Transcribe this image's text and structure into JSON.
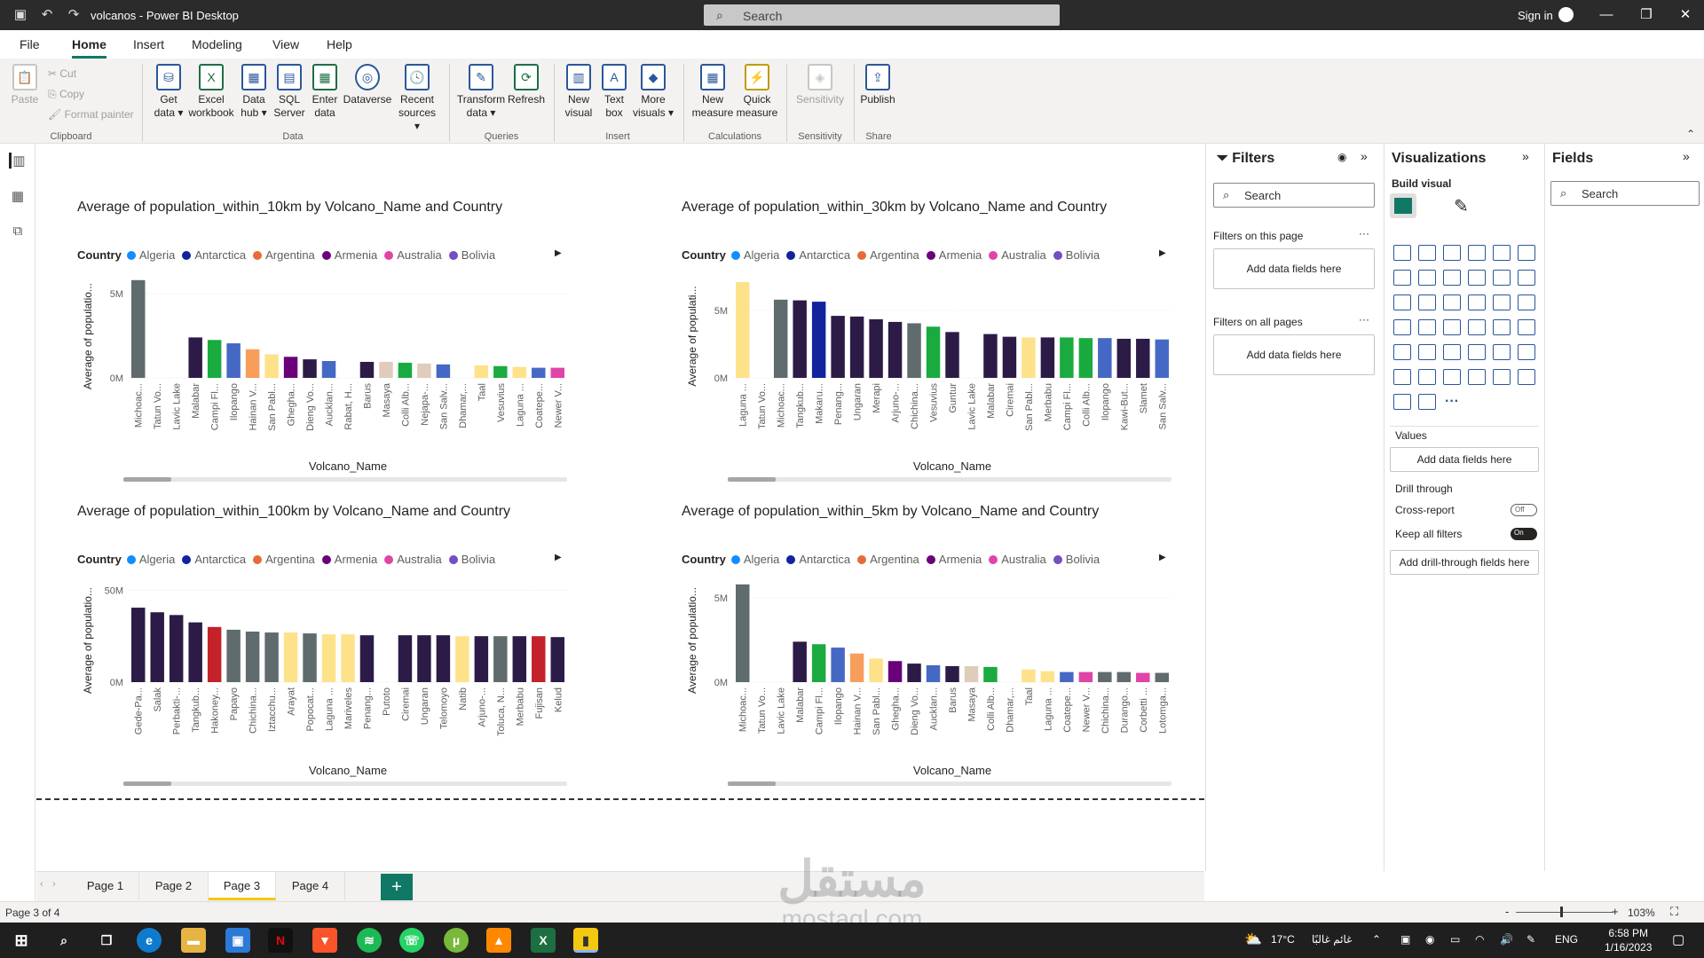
{
  "window": {
    "title": "volcanos - Power BI Desktop",
    "search_placeholder": "Search",
    "signin": "Sign in"
  },
  "menu": [
    "File",
    "Home",
    "Insert",
    "Modeling",
    "View",
    "Help"
  ],
  "ribbon": {
    "clipboard": {
      "paste": "Paste",
      "cut": "Cut",
      "copy": "Copy",
      "format_painter": "Format painter",
      "group": "Clipboard"
    },
    "data": {
      "get_data": "Get data ▾",
      "excel": "Excel workbook",
      "data_hub": "Data hub ▾",
      "sql": "SQL Server",
      "enter": "Enter data",
      "dataverse": "Dataverse",
      "recent": "Recent sources ▾",
      "group": "Data"
    },
    "queries": {
      "transform": "Transform data ▾",
      "refresh": "Refresh",
      "group": "Queries"
    },
    "insert": {
      "new_visual": "New visual",
      "text_box": "Text box",
      "more_visuals": "More visuals ▾",
      "group": "Insert"
    },
    "calculations": {
      "new_measure": "New measure",
      "quick_measure": "Quick measure",
      "group": "Calculations"
    },
    "sensitivity": {
      "sensitivity": "Sensitivity",
      "group": "Sensitivity"
    },
    "share": {
      "publish": "Publish",
      "group": "Share"
    }
  },
  "legend": {
    "label": "Country",
    "items": [
      {
        "name": "Algeria",
        "color": "#118dff"
      },
      {
        "name": "Antarctica",
        "color": "#12239e"
      },
      {
        "name": "Argentina",
        "color": "#e66c37"
      },
      {
        "name": "Armenia",
        "color": "#6b007b"
      },
      {
        "name": "Australia",
        "color": "#e044a7"
      },
      {
        "name": "Bolivia",
        "color": "#744ec2"
      }
    ]
  },
  "chart_data": [
    {
      "type": "bar",
      "title": "Average of population_within_10km by Volcano_Name and Country",
      "xlabel": "Volcano_Name",
      "ylabel": "Average of populatio...",
      "yticks": [
        "0M",
        "5M"
      ],
      "ylim": [
        0,
        6000000
      ],
      "categories": [
        "Michoac...",
        "Tatun Vo...",
        "Lavic Lake",
        "Malabar",
        "Campi Fl...",
        "Ilopango",
        "Hainan V...",
        "San Pabl...",
        "Ghegha...",
        "Dieng Vo...",
        "Aucklan...",
        "Rabat, H...",
        "Barus",
        "Masaya",
        "Colli Alb...",
        "Nejapa-...",
        "San Salv...",
        "Dhamar,...",
        "Taal",
        "Vesuvius",
        "Laguna ...",
        "Coatepe...",
        "Newer V..."
      ],
      "values": [
        5800000,
        0,
        0,
        2400000,
        2250000,
        2050000,
        1700000,
        1400000,
        1250000,
        1100000,
        1000000,
        0,
        950000,
        950000,
        900000,
        850000,
        800000,
        0,
        750000,
        700000,
        650000,
        600000,
        600000
      ],
      "colors": [
        "#5f6b6d",
        "#fff",
        "#fff",
        "#2c1b47",
        "#1aab40",
        "#4668c5",
        "#f79e5d",
        "#fde28a",
        "#6b007b",
        "#2c1b47",
        "#4668c5",
        "#fff",
        "#2c1b47",
        "#e0ccbb",
        "#1aab40",
        "#e0ccbb",
        "#4668c5",
        "#fff",
        "#fde28a",
        "#1aab40",
        "#fde28a",
        "#4668c5",
        "#e044a7"
      ]
    },
    {
      "type": "bar",
      "title": "Average of population_within_30km by Volcano_Name and Country",
      "xlabel": "Volcano_Name",
      "ylabel": "Average of populati...",
      "yticks": [
        "0M",
        "5M"
      ],
      "ylim": [
        0,
        7500000
      ],
      "categories": [
        "Laguna ...",
        "Tatun Vo...",
        "Michoac...",
        "Tangkub...",
        "Makaru...",
        "Penang...",
        "Ungaran",
        "Merapi",
        "Arjuno-...",
        "Chichina...",
        "Vesuvius",
        "Guntur",
        "Lavic Lake",
        "Malabar",
        "Ciremai",
        "San Pabl...",
        "Merbabu",
        "Campi Fl...",
        "Colli Alb...",
        "Ilopango",
        "Kawi-But...",
        "Slamet",
        "San Salv..."
      ],
      "values": [
        7100000,
        0,
        5800000,
        5750000,
        5650000,
        4600000,
        4550000,
        4350000,
        4150000,
        4050000,
        3800000,
        3400000,
        0,
        3250000,
        3050000,
        3000000,
        3000000,
        3000000,
        2950000,
        2950000,
        2900000,
        2900000,
        2850000
      ],
      "colors": [
        "#fde28a",
        "#fff",
        "#5f6b6d",
        "#2c1b47",
        "#12239e",
        "#2c1b47",
        "#2c1b47",
        "#2c1b47",
        "#2c1b47",
        "#5f6b6d",
        "#1aab40",
        "#2c1b47",
        "#fff",
        "#2c1b47",
        "#2c1b47",
        "#fde28a",
        "#2c1b47",
        "#1aab40",
        "#1aab40",
        "#4668c5",
        "#2c1b47",
        "#2c1b47",
        "#4668c5"
      ]
    },
    {
      "type": "bar",
      "title": "Average of population_within_100km by Volcano_Name and Country",
      "xlabel": "Volcano_Name",
      "ylabel": "Average of populatio...",
      "yticks": [
        "0M",
        "50M"
      ],
      "ylim": [
        0,
        55000000
      ],
      "categories": [
        "Gede-Pa...",
        "Salak",
        "Perbakti-...",
        "Tangkub...",
        "Hakoney...",
        "Papayo",
        "Chichina...",
        "Iztacchu...",
        "Arayat",
        "Popocat...",
        "Laguna ...",
        "Mariveles",
        "Penang...",
        "Putoto",
        "Ciremai",
        "Ungaran",
        "Telomoyo",
        "Natib",
        "Arjuno-...",
        "Toluca, N...",
        "Merbabu",
        "Fujisan",
        "Kelud"
      ],
      "values": [
        40500000,
        38000000,
        36500000,
        32500000,
        30000000,
        28500000,
        27500000,
        27000000,
        27000000,
        26500000,
        26000000,
        26000000,
        25500000,
        0,
        25500000,
        25500000,
        25500000,
        25000000,
        25000000,
        25000000,
        25000000,
        25000000,
        24500000
      ],
      "colors": [
        "#2c1b47",
        "#2c1b47",
        "#2c1b47",
        "#2c1b47",
        "#c3222b",
        "#5f6b6d",
        "#5f6b6d",
        "#5f6b6d",
        "#fde28a",
        "#5f6b6d",
        "#fde28a",
        "#fde28a",
        "#2c1b47",
        "#fff",
        "#2c1b47",
        "#2c1b47",
        "#2c1b47",
        "#fde28a",
        "#2c1b47",
        "#5f6b6d",
        "#2c1b47",
        "#c3222b",
        "#2c1b47"
      ]
    },
    {
      "type": "bar",
      "title": "Average of population_within_5km by Volcano_Name and Country",
      "xlabel": "Volcano_Name",
      "ylabel": "Average of populatio...",
      "yticks": [
        "0M",
        "5M"
      ],
      "ylim": [
        0,
        6000000
      ],
      "categories": [
        "Michoac...",
        "Tatun Vo...",
        "Lavic Lake",
        "Malabar",
        "Campi Fl...",
        "Ilopango",
        "Hainan V...",
        "San Pabl...",
        "Ghegha...",
        "Dieng Vo...",
        "Aucklan...",
        "Barus",
        "Masaya",
        "Colli Alb...",
        "Dhamar,...",
        "Taal",
        "Laguna ...",
        "Coatepe...",
        "Newer V...",
        "Chichina...",
        "Durango...",
        "Corbetti ...",
        "Lotomga..."
      ],
      "values": [
        5800000,
        0,
        0,
        2400000,
        2250000,
        2050000,
        1700000,
        1400000,
        1250000,
        1100000,
        1000000,
        950000,
        950000,
        900000,
        0,
        750000,
        650000,
        600000,
        600000,
        600000,
        600000,
        550000,
        550000
      ],
      "colors": [
        "#5f6b6d",
        "#fff",
        "#fff",
        "#2c1b47",
        "#1aab40",
        "#4668c5",
        "#f79e5d",
        "#fde28a",
        "#6b007b",
        "#2c1b47",
        "#4668c5",
        "#2c1b47",
        "#e0ccbb",
        "#1aab40",
        "#fff",
        "#fde28a",
        "#fde28a",
        "#4668c5",
        "#e044a7",
        "#5f6b6d",
        "#5f6b6d",
        "#e044a7",
        "#5f6b6d"
      ]
    }
  ],
  "filters": {
    "title": "Filters",
    "search": "Search",
    "this_page": "Filters on this page",
    "all_pages": "Filters on all pages",
    "add": "Add data fields here"
  },
  "viz": {
    "title": "Visualizations",
    "build": "Build visual",
    "values": "Values",
    "values_add": "Add data fields here",
    "drill": "Drill through",
    "cross": "Cross-report",
    "cross_state": "Off",
    "keep": "Keep all filters",
    "keep_state": "On",
    "drill_add": "Add drill-through fields here"
  },
  "fields": {
    "title": "Fields",
    "search": "Search"
  },
  "pages": [
    "Page 1",
    "Page 2",
    "Page 3",
    "Page 4"
  ],
  "status": {
    "page": "Page 3 of 4",
    "zoom": "103%"
  },
  "taskbar": {
    "weather": "17°C",
    "weather_text": "غائم غالبًا",
    "lang": "ENG",
    "time": "6:58 PM",
    "date": "1/16/2023"
  },
  "watermark": {
    "ar": "مستقل",
    "en": "mostaql.com"
  }
}
